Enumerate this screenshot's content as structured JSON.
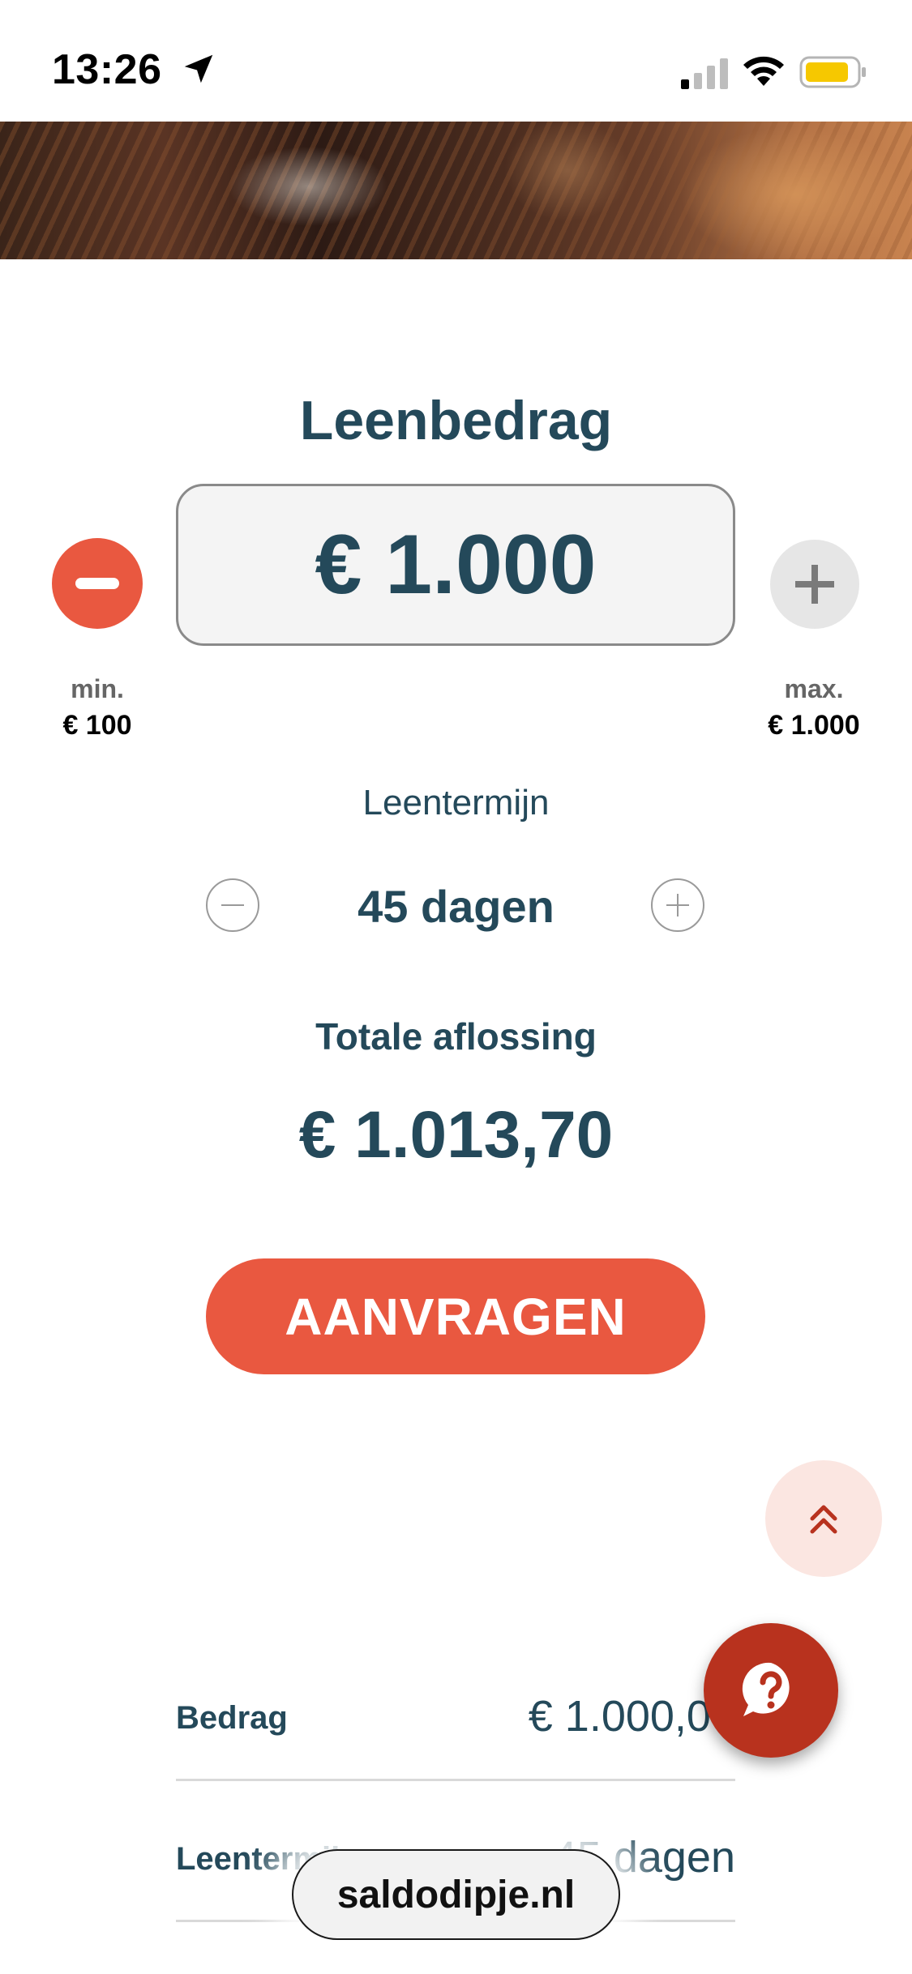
{
  "status_bar": {
    "time": "13:26",
    "icons": [
      "location-arrow-icon",
      "cellular-signal-icon",
      "wifi-icon",
      "battery-icon"
    ],
    "battery_color": "#f6c800"
  },
  "calculator": {
    "title": "Leenbedrag",
    "amount": "€ 1.000",
    "min_label": "min.",
    "min_value": "€ 100",
    "max_label": "max.",
    "max_value": "€ 1.000",
    "term_title": "Leentermijn",
    "term_value": "45 dagen",
    "total_label": "Totale aflossing",
    "total_value": "€ 1.013,70",
    "apply_label": "AANVRAGEN"
  },
  "summary": {
    "rows": [
      {
        "label": "Bedrag",
        "value": "€ 1.000,00"
      },
      {
        "label": "Leentermijn",
        "value": "45 dagen"
      }
    ]
  },
  "browser": {
    "domain": "saldodipje.nl"
  },
  "colors": {
    "primary_text": "#24495a",
    "accent": "#e95840",
    "help_button": "#b8321e",
    "scroll_top_bg": "#fbe6e1"
  }
}
